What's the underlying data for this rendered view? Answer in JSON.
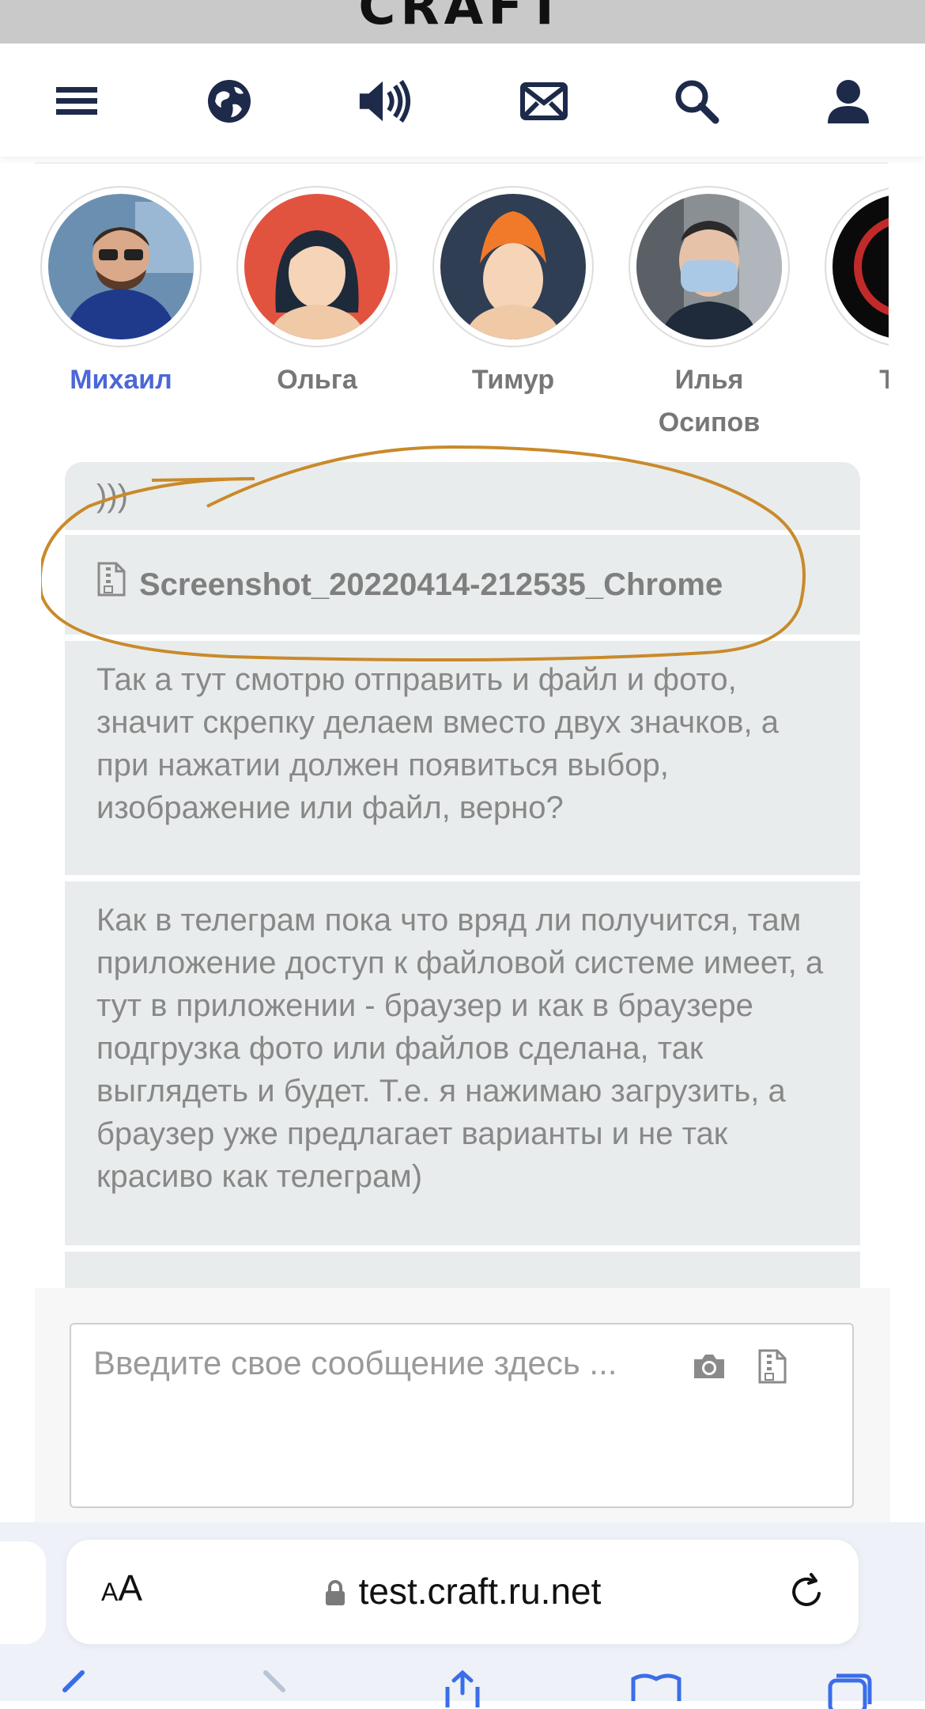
{
  "brand": {
    "logo_text": "CRAFT"
  },
  "nav": {
    "icons": [
      "menu-icon",
      "globe-icon",
      "speaker-icon",
      "mail-icon",
      "search-icon",
      "user-icon"
    ]
  },
  "stories": {
    "items": [
      {
        "name": "Михаил",
        "active": true
      },
      {
        "name": "Ольга",
        "active": false
      },
      {
        "name": "Тимур",
        "active": false
      },
      {
        "name": "Илья Осипов",
        "active": false
      },
      {
        "name": "Тим",
        "active": false
      }
    ]
  },
  "chat": {
    "messages": [
      {
        "text": ")))"
      },
      {
        "file_name": "Screenshot_20220414-212535_Chrome",
        "icon": "file-zip-icon"
      },
      {
        "text": "Так а тут смотрю отправить и файл и фото, значит скрепку делаем вместо двух значков, а при нажатии должен появиться выбор, изображение или файл, верно?"
      },
      {
        "text": "Как в телеграм пока что вряд ли получится, там приложение доступ к файловой системе имеет, а тут в приложении - браузер и как в браузере подгрузка фото или файлов сделана, так выглядеть и будет. Т.е. я нажимаю загрузить, а браузер уже предлагает варианты и не так красиво как телеграм)"
      }
    ]
  },
  "composer": {
    "placeholder": "Введите свое сообщение здесь ...",
    "icons": [
      "camera-icon",
      "file-zip-icon"
    ]
  },
  "browser": {
    "aa_label_small": "A",
    "aa_label_large": "A",
    "url": "test.craft.ru.net",
    "colors": {
      "accent": "#4b67d8",
      "annotation": "#c98a2b"
    }
  }
}
